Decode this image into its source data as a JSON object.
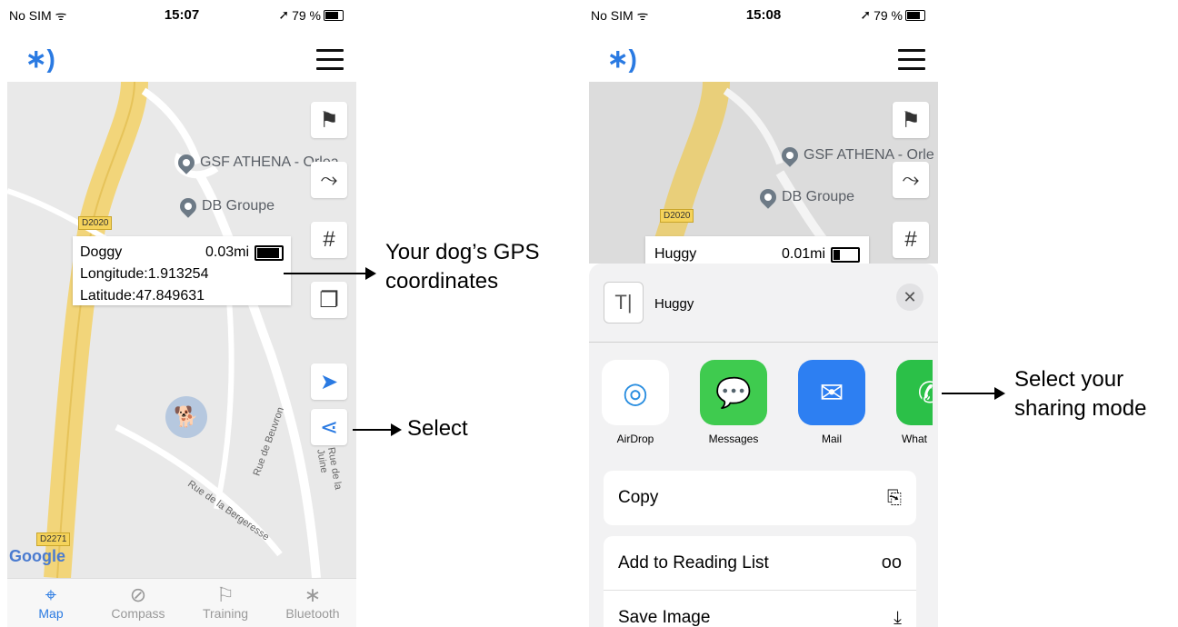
{
  "phone1": {
    "status": {
      "carrier": "No SIM ᯤ",
      "time": "15:07",
      "battery": "79 %"
    },
    "pois": [
      "GSF ATHENA - Orlea",
      "DB Groupe"
    ],
    "roads": [
      "D2020",
      "D2271"
    ],
    "streets": [
      "Rue de Beuvron",
      "Rue de la Bergeresse",
      "Rue de la Juine"
    ],
    "info_card": {
      "name": "Doggy",
      "distance": "0.03mi",
      "battery_level": 1.0,
      "longitude": "Longitude:1.913254",
      "latitude": "Latitude:47.849631"
    },
    "google": "Google",
    "tabs": [
      {
        "label": "Map",
        "icon": "map-pin-icon",
        "active": true
      },
      {
        "label": "Compass",
        "icon": "compass-icon",
        "active": false
      },
      {
        "label": "Training",
        "icon": "flag-icon",
        "active": false
      },
      {
        "label": "Bluetooth",
        "icon": "bluetooth-icon",
        "active": false
      }
    ]
  },
  "phone2": {
    "status": {
      "carrier": "No SIM ᯤ",
      "time": "15:08",
      "battery": "79 %"
    },
    "pois": [
      "GSF ATHENA - Orle",
      "DB Groupe"
    ],
    "roads": [
      "D2020"
    ],
    "info_card": {
      "name": "Huggy",
      "distance": "0.01mi",
      "battery_level": 0.25
    },
    "share_sheet": {
      "title": "Huggy",
      "apps": [
        "AirDrop",
        "Messages",
        "Mail",
        "What"
      ],
      "actions": [
        {
          "label": "Copy",
          "icon": "copy-icon"
        },
        {
          "label": "Add to Reading List",
          "icon": "glasses-icon"
        },
        {
          "label": "Save Image",
          "icon": "download-icon"
        }
      ]
    }
  },
  "callouts": {
    "gps_line1": "Your dog’s GPS",
    "gps_line2": "coordinates",
    "select": "Select",
    "sharing_line1": "Select your",
    "sharing_line2": "sharing mode"
  },
  "colors": {
    "accent": "#2a7ae2",
    "map_bg": "#e9e9e9",
    "road_yellow": "#f5d35b"
  }
}
